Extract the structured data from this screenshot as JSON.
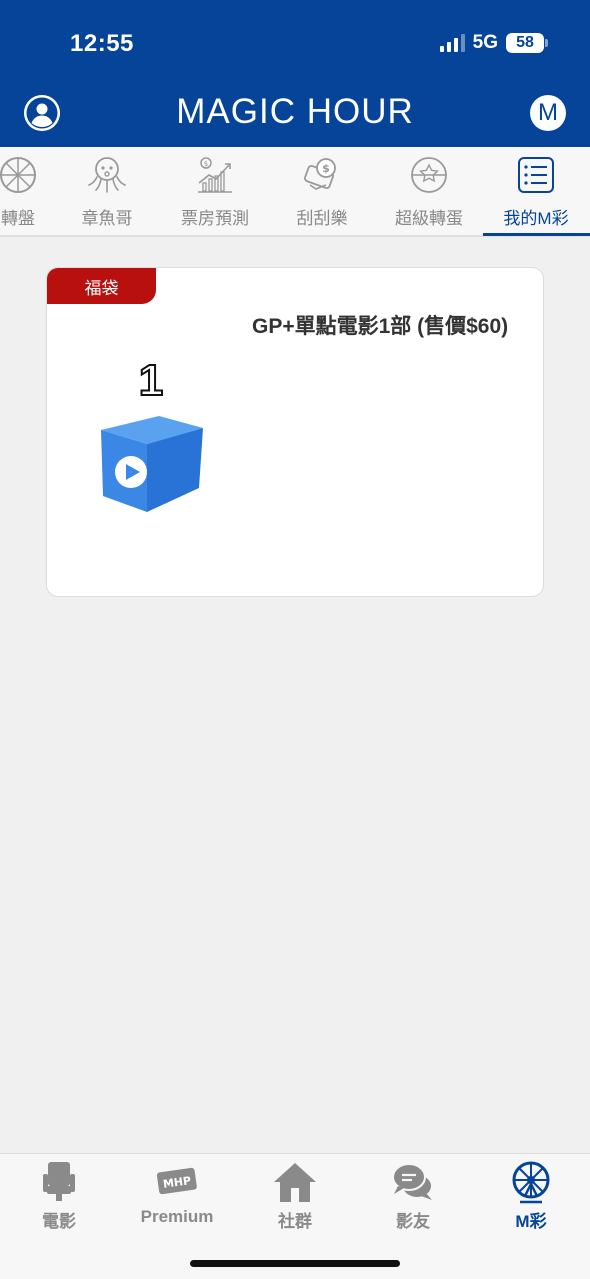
{
  "status": {
    "time": "12:55",
    "network": "5G",
    "battery": "58"
  },
  "header": {
    "title": "MAGIC HOUR",
    "profile_icon": "user-icon",
    "m_button": "M"
  },
  "tabs": [
    {
      "label": "轉盤",
      "icon": "wheel-icon"
    },
    {
      "label": "章魚哥",
      "icon": "octopus-icon"
    },
    {
      "label": "票房預測",
      "icon": "chart-icon"
    },
    {
      "label": "刮刮樂",
      "icon": "scratch-card-icon"
    },
    {
      "label": "超級轉蛋",
      "icon": "capsule-icon"
    },
    {
      "label": "我的M彩",
      "icon": "list-icon",
      "active": true
    }
  ],
  "card": {
    "badge": "福袋",
    "quantity": "1",
    "title": "GP+單點電影1部 (售價$60)",
    "image_icon": "blue-box-play-icon"
  },
  "bottom_nav": [
    {
      "label": "電影",
      "icon": "seat-icon"
    },
    {
      "label": "Premium",
      "icon": "mhp-ticket-icon"
    },
    {
      "label": "社群",
      "icon": "home-icon"
    },
    {
      "label": "影友",
      "icon": "chat-icon"
    },
    {
      "label": "M彩",
      "icon": "ferris-wheel-icon",
      "active": true
    }
  ],
  "colors": {
    "primary": "#06449a",
    "badge": "#b80f0f",
    "background": "#f0f0f0"
  }
}
